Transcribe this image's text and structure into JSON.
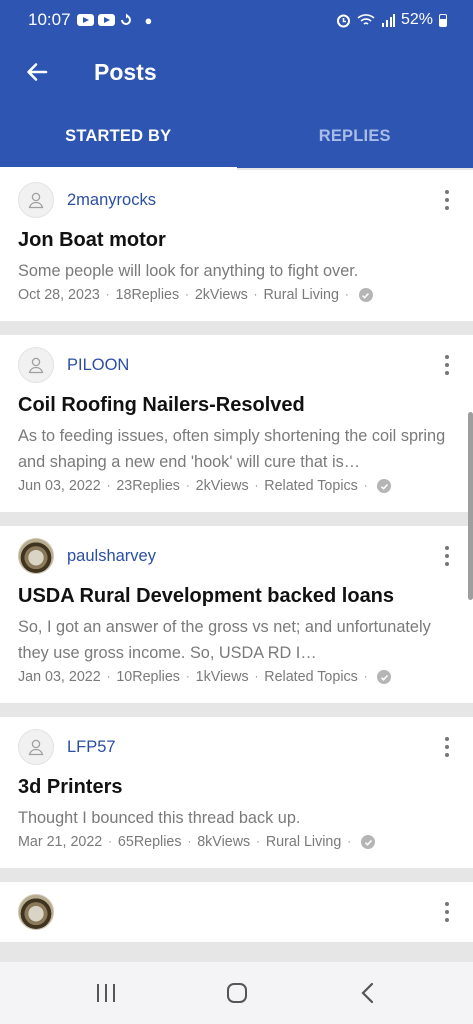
{
  "status_bar": {
    "time": "10:07",
    "battery": "52%",
    "left_icons": [
      "youtube-icon",
      "youtube-icon",
      "sync-icon",
      "dot-icon"
    ],
    "right_icons": [
      "alarm-icon",
      "wifi-icon",
      "signal-icon",
      "battery-icon"
    ]
  },
  "app_bar": {
    "title": "Posts",
    "back_icon": "arrow-left-icon"
  },
  "tabs": [
    {
      "label": "STARTED BY",
      "active": true
    },
    {
      "label": "REPLIES",
      "active": false
    }
  ],
  "posts": [
    {
      "user": "2manyrocks",
      "avatar": "placeholder",
      "title": "Jon Boat motor",
      "excerpt": "Some people will look for anything to fight over.",
      "date": "Oct 28, 2023",
      "replies": "18Replies",
      "views": "2kViews",
      "category": "Rural Living"
    },
    {
      "user": "PILOON",
      "avatar": "placeholder",
      "title": "Coil Roofing Nailers-Resolved",
      "excerpt": "As to feeding issues, often simply shortening the coil spring and shaping a new end 'hook' will cure that is…",
      "date": "Jun 03, 2022",
      "replies": "23Replies",
      "views": "2kViews",
      "category": "Related Topics"
    },
    {
      "user": "paulsharvey",
      "avatar": "photo",
      "title": "USDA Rural Development backed loans",
      "excerpt": "So, I got an answer of the gross vs net; and unfortunately they use gross income. So, USDA RD I…",
      "date": "Jan 03, 2022",
      "replies": "10Replies",
      "views": "1kViews",
      "category": "Related Topics"
    },
    {
      "user": "LFP57",
      "avatar": "placeholder",
      "title": "3d Printers",
      "excerpt": "Thought I bounced this thread back up.",
      "date": "Mar 21, 2022",
      "replies": "65Replies",
      "views": "8kViews",
      "category": "Rural Living"
    }
  ],
  "meta_separator": "·",
  "nav_bar": {
    "icons": [
      "recent-apps-icon",
      "home-icon",
      "back-icon"
    ]
  },
  "colors": {
    "primary": "#2d55b1",
    "username": "#2b4fa3",
    "tab_inactive": "#a9bce7"
  }
}
